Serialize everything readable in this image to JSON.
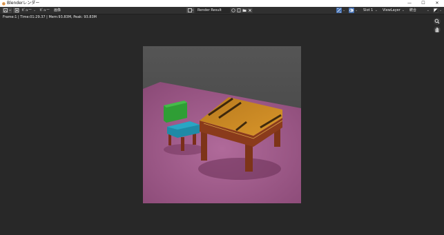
{
  "window": {
    "title": "Blenderレンダー",
    "minimize_glyph": "—",
    "maximize_glyph": "☐",
    "close_glyph": "✕"
  },
  "header": {
    "menu_view": "ビュー",
    "menu_view2": "ビュー",
    "menu_image": "画像",
    "image_name": "Render Result",
    "slot": "Slot 1",
    "view_layer": "ViewLayer",
    "pass": "統合"
  },
  "status": {
    "render_info": "Frame:1 | Time:01:29.37 | Mem:93.83M, Peak: 93.83M"
  },
  "icons": {
    "logo": "blender-logo-icon",
    "editor_type": "image-editor-icon",
    "mode": "view-mode-icon",
    "image_browse": "image-browse-icon",
    "zoom": "zoom-icon",
    "pan": "hand-icon"
  },
  "colors": {
    "background": "#282828",
    "header": "#303030",
    "accent_blue": "#4772b3",
    "floor": "#a25c8c",
    "table_top": "#c98522",
    "table_legs": "#8a3b1b",
    "chair_back": "#33a33a",
    "chair_seat": "#1f8aa6"
  }
}
